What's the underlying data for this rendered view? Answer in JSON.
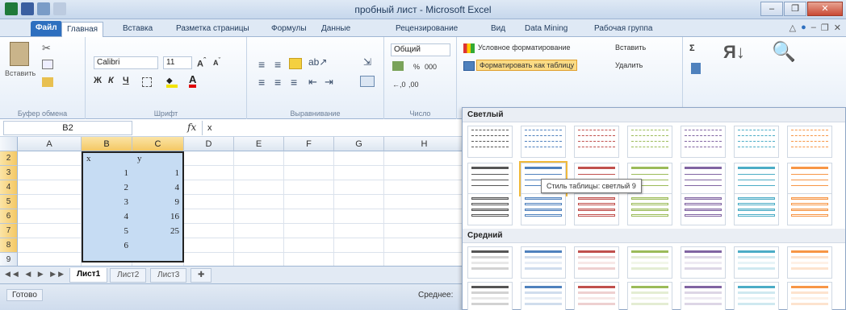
{
  "window": {
    "title": "пробный лист - Microsoft Excel"
  },
  "tabs": [
    "Файл",
    "Главная",
    "Вставка",
    "Разметка страницы",
    "Формулы",
    "Данные",
    "Рецензирование",
    "Вид",
    "Data Mining",
    "Рабочая группа"
  ],
  "ribbon": {
    "clipboard": {
      "paste": "Вставить",
      "label": "Буфер обмена"
    },
    "font": {
      "name": "Calibri",
      "size": "11",
      "label": "Шрифт",
      "bold": "Ж",
      "italic": "К",
      "underline": "Ч"
    },
    "alignment": {
      "label": "Выравнивание"
    },
    "number": {
      "format": "Общий",
      "label": "Число",
      "percent": "%",
      "thousands": "000"
    },
    "styles": {
      "conditional": "Условное форматирование",
      "as_table": "Форматировать как таблицу"
    },
    "cells": {
      "insert": "Вставить",
      "delete": "Удалить"
    },
    "editing": {
      "sum": "Σ"
    }
  },
  "formula_bar": {
    "cell_ref": "B2",
    "fx": "fx",
    "content": "x"
  },
  "sheet": {
    "columns": [
      "A",
      "B",
      "C",
      "D",
      "E",
      "F",
      "G",
      "H"
    ],
    "rows": [
      "2",
      "3",
      "4",
      "5",
      "6",
      "7",
      "8",
      "9"
    ],
    "headers": {
      "b2": "x",
      "c2": "y"
    },
    "x_values": [
      "1",
      "2",
      "3",
      "4",
      "5",
      "6"
    ],
    "y_values": [
      "1",
      "4",
      "9",
      "16",
      "25",
      ""
    ]
  },
  "sheet_tabs": [
    "Лист1",
    "Лист2",
    "Лист3"
  ],
  "status": {
    "ready": "Готово",
    "average": "Среднее:"
  },
  "gallery": {
    "light_label": "Светлый",
    "medium_label": "Средний",
    "tooltip": "Стиль таблицы: светлый 9",
    "colors": [
      "#555555",
      "#4f81bd",
      "#c0504d",
      "#9bbb59",
      "#8064a2",
      "#4bacc6",
      "#f79646"
    ]
  }
}
